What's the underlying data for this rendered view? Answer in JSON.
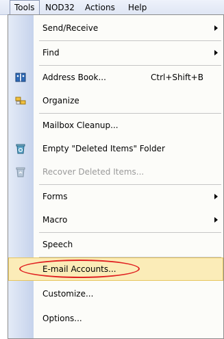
{
  "menubar": {
    "items": [
      {
        "label": "Tools"
      },
      {
        "label": "NOD32"
      },
      {
        "label": "Actions"
      },
      {
        "label": "Help"
      }
    ]
  },
  "menu": {
    "items": [
      {
        "label": "Send/Receive"
      },
      {
        "label": "Find"
      },
      {
        "label": "Address Book...",
        "shortcut": "Ctrl+Shift+B"
      },
      {
        "label": "Organize"
      },
      {
        "label": "Mailbox Cleanup..."
      },
      {
        "label": "Empty \"Deleted Items\" Folder"
      },
      {
        "label": "Recover Deleted Items..."
      },
      {
        "label": "Forms"
      },
      {
        "label": "Macro"
      },
      {
        "label": "Speech"
      },
      {
        "label": "E-mail Accounts..."
      },
      {
        "label": "Customize..."
      },
      {
        "label": "Options..."
      }
    ]
  },
  "colors": {
    "highlight": "#fbecb8",
    "annotation_circle": "#e02020",
    "disabled_text": "#9a9a9a"
  },
  "icons": [
    "address-book-icon",
    "organize-icon",
    "empty-trash-icon",
    "recover-items-icon"
  ]
}
